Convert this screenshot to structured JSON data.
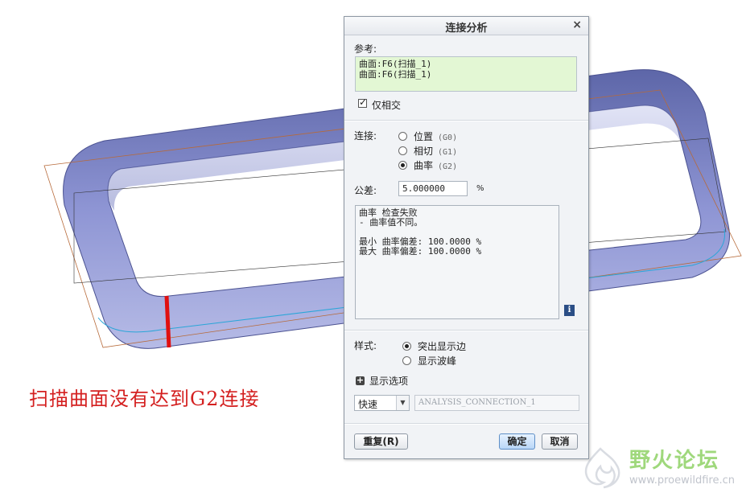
{
  "caption": "扫描曲面没有达到G2连接",
  "watermark": {
    "name": "野火论坛",
    "url": "www.proewildfire.cn"
  },
  "dialog": {
    "title": "连接分析",
    "close_label": "×",
    "reference_label": "参考:",
    "references": [
      "曲面:F6(扫描_1)",
      "曲面:F6(扫描_1)"
    ],
    "intersect_only_label": "仅相交",
    "connection_label": "连接:",
    "connection_options": [
      {
        "label": "位置",
        "code": "(G0)"
      },
      {
        "label": "相切",
        "code": "(G1)"
      },
      {
        "label": "曲率",
        "code": "(G2)"
      }
    ],
    "tolerance_label": "公差:",
    "tolerance_value": "5.000000",
    "tolerance_unit": "%",
    "result_lines": [
      "曲率 检查失败",
      "- 曲率值不同。",
      "",
      "最小 曲率偏差: 100.0000 %",
      "最大 曲率偏差: 100.0000 %"
    ],
    "info_label": "i",
    "style_label": "样式:",
    "style_options": [
      "突出显示边",
      "显示波峰"
    ],
    "display_options_label": "显示选项",
    "mode_value": "快速",
    "analysis_name": "ANALYSIS_CONNECTION_1",
    "repeat_button": "重复(R)",
    "ok_button": "确定",
    "cancel_button": "取消"
  },
  "colors": {
    "surface": "#8d94d2",
    "highlight": "#e01010",
    "caption": "#d42020",
    "accent_green": "#e3f7d4"
  }
}
